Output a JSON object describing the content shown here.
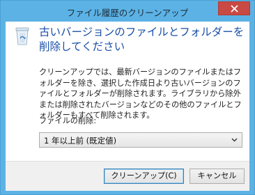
{
  "window": {
    "title": "ファイル履歴のクリーンアップ"
  },
  "dialog": {
    "heading": "古いバージョンのファイルとフォルダーを削除してください",
    "description": "クリーンアップでは、最新バージョンのファイルまたはフォルダーを除き、選択した作成日より古いバージョンのファイルとフォルダーが削除されます。ライブラリから除外または削除されたバージョンなどのその他のファイルとフォルダーもすべて削除されます。",
    "delete_label": "ファイルの削除:",
    "delete_selected": "1 年以上前 (既定値)"
  },
  "buttons": {
    "cleanup": "クリーンアップ(C)",
    "cancel": "キャンセル"
  },
  "icons": {
    "header": "recycle-bin-icon",
    "close": "close-icon",
    "dropdown": "chevron-down-icon"
  },
  "colors": {
    "frame": "#5cb2e5",
    "heading": "#1a4fa8",
    "close": "#c94a42"
  }
}
